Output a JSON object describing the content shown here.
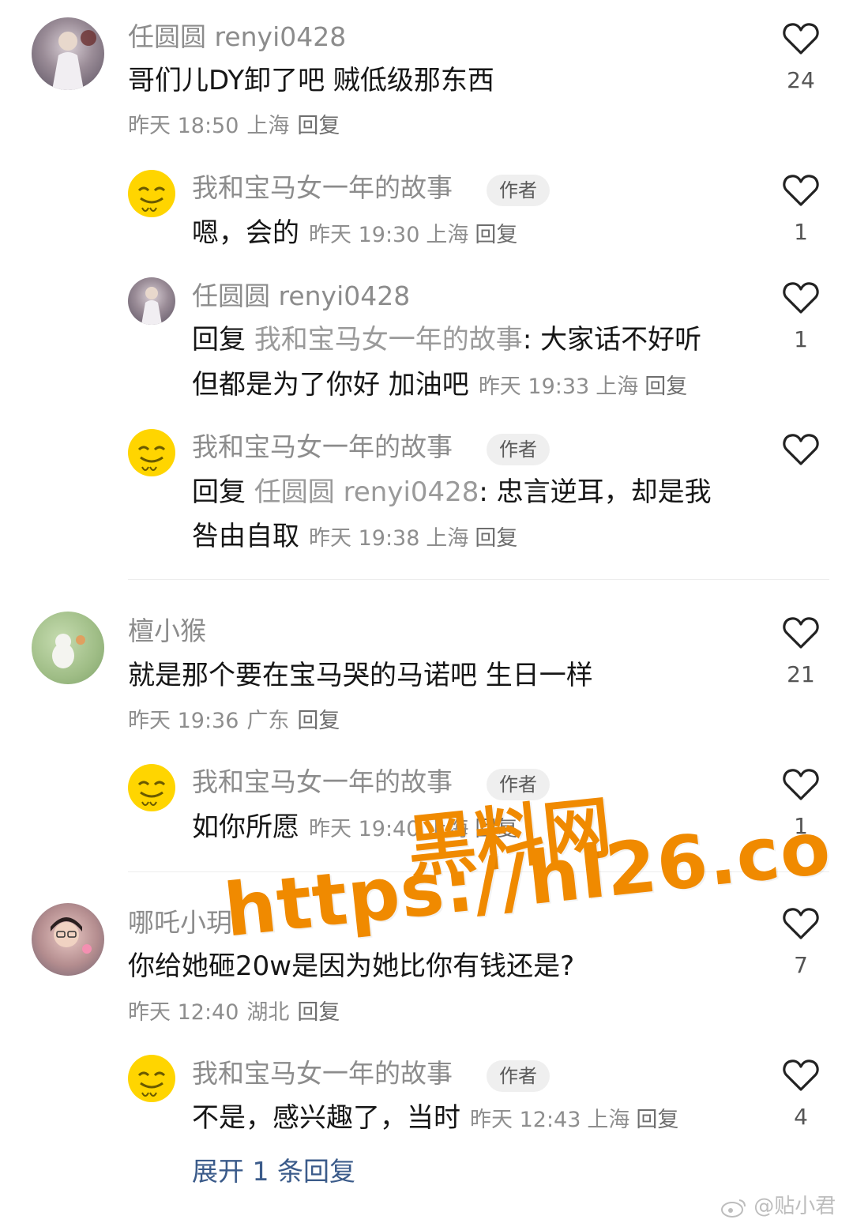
{
  "threads": [
    {
      "comment": {
        "name": "任圆圆 renyi0428",
        "text": "哥们儿DY卸了吧 贼低级那东西",
        "time": "昨天 18:50",
        "location": "上海",
        "reply": "回复",
        "likes": "24"
      },
      "replies": [
        {
          "name": "我和宝马女一年的故事",
          "badge": "作者",
          "line1": "嗯，会的",
          "time": "昨天 19:30",
          "location": "上海",
          "reply": "回复",
          "likes": "1"
        },
        {
          "name": "任圆圆 renyi0428",
          "line1_prefix": "回复",
          "line1_target": "我和宝马女一年的故事",
          "line1_rest": ": 大家话不好听",
          "line2": "但都是为了你好 加油吧",
          "time": "昨天 19:33",
          "location": "上海",
          "reply": "回复",
          "likes": "1"
        },
        {
          "name": "我和宝马女一年的故事",
          "badge": "作者",
          "line1_prefix": "回复",
          "line1_target": "任圆圆 renyi0428",
          "line1_rest": ": 忠言逆耳，却是我",
          "line2": "咎由自取",
          "time": "昨天 19:38",
          "location": "上海",
          "reply": "回复",
          "likes": ""
        }
      ]
    },
    {
      "comment": {
        "name": "檀小猴",
        "text": "就是那个要在宝马哭的马诺吧 生日一样",
        "time": "昨天 19:36",
        "location": "广东",
        "reply": "回复",
        "likes": "21"
      },
      "replies": [
        {
          "name": "我和宝马女一年的故事",
          "badge": "作者",
          "line1": "如你所愿",
          "time": "昨天 19:40",
          "location": "上海",
          "reply": "回复",
          "likes": "1"
        }
      ]
    },
    {
      "comment": {
        "name": "哪吒小玥",
        "text": "你给她砸20w是因为她比你有钱还是?",
        "time": "昨天 12:40",
        "location": "湖北",
        "reply": "回复",
        "likes": "7"
      },
      "replies": [
        {
          "name": "我和宝马女一年的故事",
          "badge": "作者",
          "line1": "不是，感兴趣了，当时",
          "time": "昨天 12:43",
          "location": "上海",
          "reply": "回复",
          "likes": "4"
        }
      ],
      "expand": "展开 1 条回复"
    }
  ],
  "watermark": {
    "line1": "黑料网",
    "line2": "https://hl26.co"
  },
  "weibo": "@贴小君",
  "colors": {
    "watermark": "#f08a00",
    "link": "#3b5b8a",
    "emoji_avatar": "#ffd500"
  }
}
